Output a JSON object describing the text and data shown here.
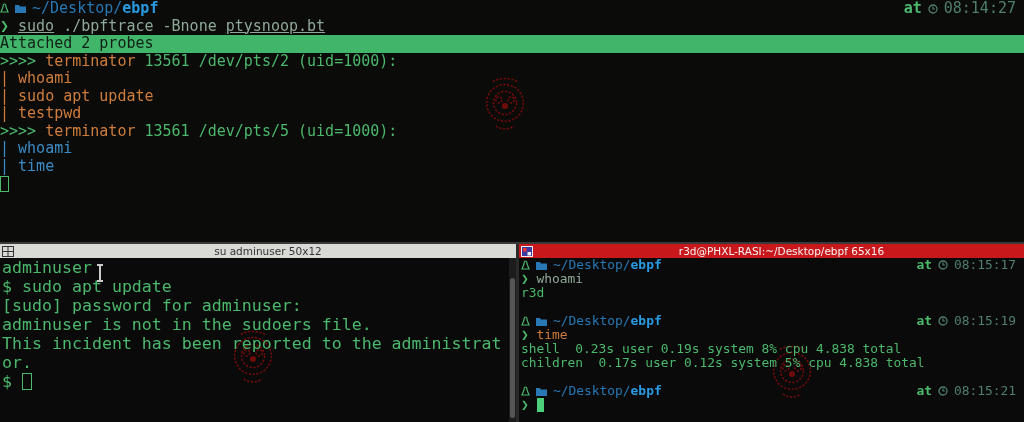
{
  "top_pane": {
    "lines": [
      {
        "kind": "prompt",
        "path": "~/Desktop/**ebpf**",
        "at": "at",
        "time": "08:14:27"
      },
      {
        "kind": "command",
        "symbol": "❯",
        "segments": [
          {
            "text": "sudo",
            "color": "#8fa898",
            "underlined": true
          },
          {
            "text": " ./bpftrace -Bnone ",
            "color": "#8fa898"
          },
          {
            "text": "ptysnoop.bt",
            "color": "#8fa898",
            "underlined": true
          }
        ]
      },
      {
        "kind": "highlight",
        "text": "Attached 2 probes"
      },
      {
        "kind": "text",
        "segments": [
          {
            "text": ">>>> ",
            "color": "#4cb86c"
          },
          {
            "text": "terminator",
            "color": "#cf7d3c"
          },
          {
            "text": " 13561 /dev/pts/2 (uid=1000):",
            "color": "#4cb86c"
          }
        ]
      },
      {
        "kind": "text",
        "segments": [
          {
            "text": "| whoami",
            "color": "#cf7d3c"
          }
        ]
      },
      {
        "kind": "text",
        "segments": [
          {
            "text": "| sudo apt update",
            "color": "#cf7d3c"
          }
        ]
      },
      {
        "kind": "text",
        "segments": [
          {
            "text": "| testpwd",
            "color": "#cf7d3c"
          }
        ]
      },
      {
        "kind": "text",
        "segments": [
          {
            "text": ">>>> ",
            "color": "#4cb86c"
          },
          {
            "text": "terminator",
            "color": "#cf7d3c"
          },
          {
            "text": " 13561 /dev/pts/5 (uid=1000):",
            "color": "#4cb86c"
          }
        ]
      },
      {
        "kind": "text",
        "segments": [
          {
            "text": "| whoami",
            "color": "#3b8bc4"
          }
        ]
      },
      {
        "kind": "text",
        "segments": [
          {
            "text": "| time",
            "color": "#3b8bc4"
          }
        ]
      },
      {
        "kind": "cursor",
        "filled": false
      }
    ]
  },
  "bottom_left_pane": {
    "title": "su adminuser 50x12",
    "focused": false,
    "lines": [
      {
        "kind": "text",
        "segments": [
          {
            "text": "adminuser",
            "color": "#4cb86c"
          }
        ]
      },
      {
        "kind": "text",
        "segments": [
          {
            "text": "$ sudo apt update",
            "color": "#4cb86c"
          }
        ]
      },
      {
        "kind": "text",
        "segments": [
          {
            "text": "[sudo] password for adminuser:",
            "color": "#4cb86c"
          }
        ]
      },
      {
        "kind": "text",
        "segments": [
          {
            "text": "adminuser is not in the sudoers file.",
            "color": "#4cb86c"
          }
        ]
      },
      {
        "kind": "text",
        "segments": [
          {
            "text": "This incident has been reported to the administrat",
            "color": "#4cb86c"
          }
        ]
      },
      {
        "kind": "text",
        "segments": [
          {
            "text": "or.",
            "color": "#4cb86c"
          }
        ]
      },
      {
        "kind": "cursor",
        "prefix": "$ ",
        "filled": false
      }
    ]
  },
  "bottom_right_pane": {
    "title": "r3d@PHXL-RASI:~/Desktop/ebpf 65x16",
    "focused": true,
    "lines": [
      {
        "kind": "prompt",
        "path": "~/Desktop/**ebpf**",
        "at": "at",
        "time": "08:15:17"
      },
      {
        "kind": "command",
        "symbol": "❯",
        "segments": [
          {
            "text": "whoami",
            "color": "#8fa898"
          }
        ]
      },
      {
        "kind": "text",
        "segments": [
          {
            "text": "r3d",
            "color": "#4cb86c"
          }
        ]
      },
      {
        "kind": "blank"
      },
      {
        "kind": "prompt",
        "path": "~/Desktop/**ebpf**",
        "at": "at",
        "time": "08:15:19"
      },
      {
        "kind": "command",
        "symbol": "❯",
        "segments": [
          {
            "text": "time",
            "color": "#cf7d3c"
          }
        ]
      },
      {
        "kind": "text",
        "segments": [
          {
            "text": "shell  0.23s user 0.19s system 8% cpu 4.838 total",
            "color": "#4cb86c"
          }
        ]
      },
      {
        "kind": "text",
        "segments": [
          {
            "text": "children  0.17s user 0.12s system 5% cpu 4.838 total",
            "color": "#4cb86c"
          }
        ]
      },
      {
        "kind": "blank"
      },
      {
        "kind": "prompt",
        "path": "~/Desktop/**ebpf**",
        "at": "at",
        "time": "08:15:21"
      },
      {
        "kind": "cursor",
        "symbol": "❯",
        "filled": true
      }
    ]
  }
}
